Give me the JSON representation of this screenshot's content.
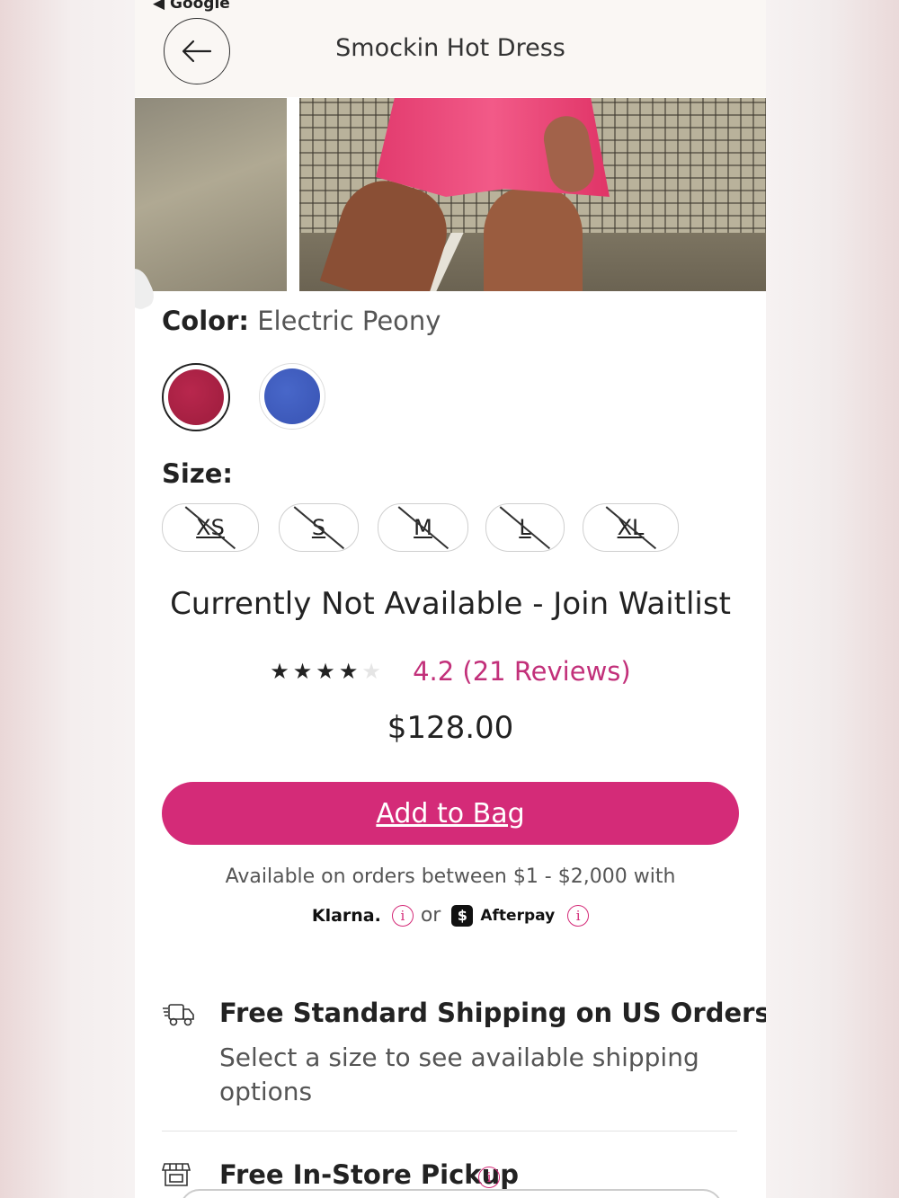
{
  "status_bar": {
    "back_app": "◀ Google"
  },
  "header": {
    "title": "Smockin Hot Dress",
    "back_icon": "arrow-left-icon"
  },
  "product": {
    "color_label": "Color:",
    "color_value": "Electric Peony",
    "swatches": [
      {
        "name": "Electric Peony",
        "color": "#a82245",
        "selected": true
      },
      {
        "name": "Blue",
        "color": "#4361c3",
        "selected": false
      }
    ],
    "size_label": "Size:",
    "sizes": [
      "XS",
      "S",
      "M",
      "L",
      "XL"
    ],
    "availability": "Currently Not Available - Join Waitlist",
    "rating": {
      "stars": 4.2,
      "text": "4.2 (21 Reviews)"
    },
    "price": "$128.00"
  },
  "cta": {
    "add_to_bag": "Add to Bag"
  },
  "bnpl": {
    "line": "Available on orders between $1 - $2,000 with",
    "klarna": "Klarna.",
    "or": "or",
    "afterpay_badge": "$",
    "afterpay": "Afterpay"
  },
  "shipping": {
    "title": "Free Standard Shipping on US Orders",
    "subtitle": "Select a size to see available shipping options"
  },
  "pickup": {
    "title": "Free In-Store Pickup"
  },
  "colors": {
    "accent": "#d42b78",
    "rating_text": "#c2307a"
  }
}
